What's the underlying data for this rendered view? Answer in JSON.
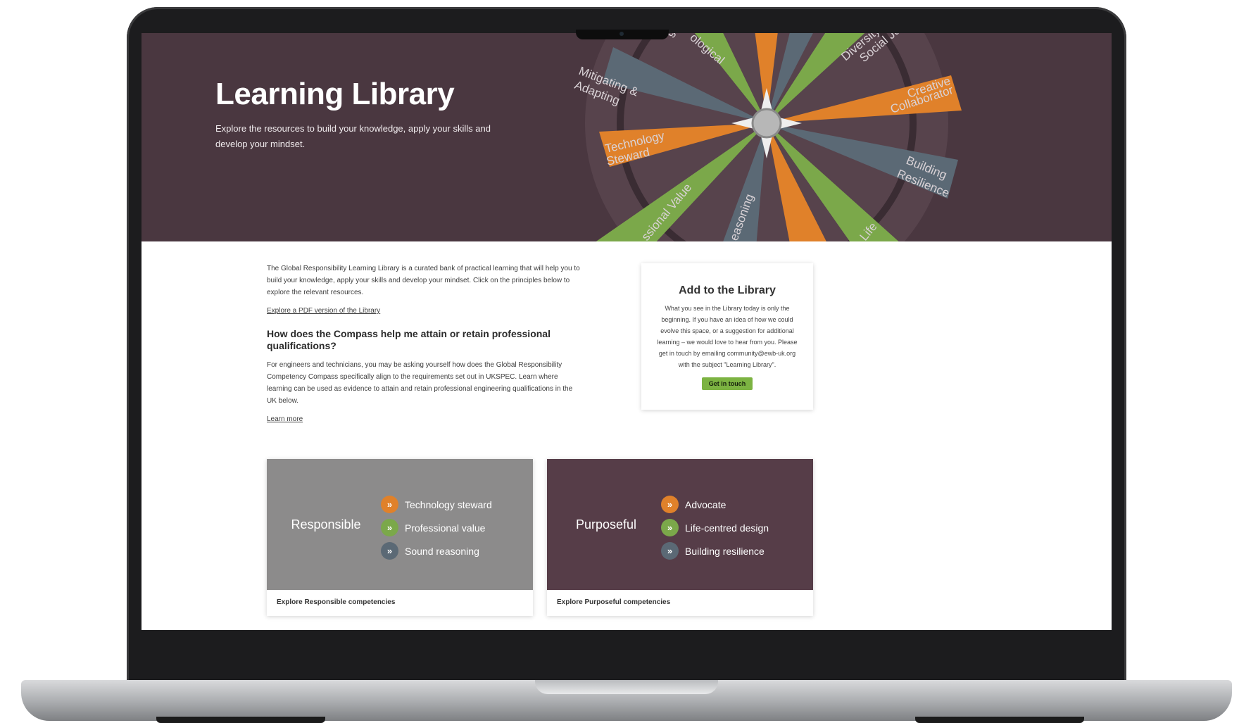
{
  "colors": {
    "hero_background": "#4a3740",
    "orange": "#e0812a",
    "green": "#7ba84a",
    "slate": "#5b6975",
    "button_green": "#7cb342",
    "responsible_panel": "#8c8b8b",
    "purposeful_panel": "#563d48"
  },
  "hero": {
    "title": "Learning Library",
    "subtitle": "Explore the resources to build your knowledge, apply your skills and develop your mindset."
  },
  "compass": {
    "labels": [
      "Mitigating &",
      "Adapting",
      "Technology",
      "Steward",
      "Creative",
      "Collaborator",
      "Building",
      "Resilience",
      "Diversity,",
      "Social Ju",
      "ological",
      "g",
      "ssional Value",
      "easoning",
      "Life"
    ]
  },
  "main": {
    "intro": "The Global Responsibility Learning Library is a curated bank of practical learning that will help you to build your knowledge, apply your skills and develop your mindset. Click on the principles below to explore the relevant resources.",
    "pdf_link": "Explore a PDF version of the Library",
    "question_heading": "How does the Compass help me attain or retain professional qualifications?",
    "question_body": "For engineers and technicians, you may be asking yourself how does the Global Responsibility Competency Compass specifically align to the requirements set out in UKSPEC. Learn where learning can be used as evidence to attain and retain professional engineering qualifications in the UK below.",
    "learn_more": "Learn more"
  },
  "add_card": {
    "title": "Add to the Library",
    "body": "What you see in the Library today is only the beginning. If you have an idea of how we could evolve this space, or a suggestion for additional learning – we would love to hear from you. Please get in touch by emailing community@ewb-uk.org with the subject \"Learning Library\".",
    "button": "Get in touch"
  },
  "tiles": [
    {
      "name": "Responsible",
      "items": [
        {
          "label": "Technology steward",
          "icon": "chevron-double-right-icon",
          "color": "#e0812a"
        },
        {
          "label": "Professional value",
          "icon": "chevron-double-right-icon",
          "color": "#7ba84a"
        },
        {
          "label": "Sound reasoning",
          "icon": "chevron-double-right-icon",
          "color": "#5b6975"
        }
      ],
      "caption": "Explore Responsible competencies"
    },
    {
      "name": "Purposeful",
      "items": [
        {
          "label": "Advocate",
          "icon": "chevron-double-right-icon",
          "color": "#e0812a"
        },
        {
          "label": "Life-centred design",
          "icon": "chevron-double-right-icon",
          "color": "#7ba84a"
        },
        {
          "label": "Building resilience",
          "icon": "chevron-double-right-icon",
          "color": "#5b6975"
        }
      ],
      "caption": "Explore Purposeful competencies"
    }
  ]
}
